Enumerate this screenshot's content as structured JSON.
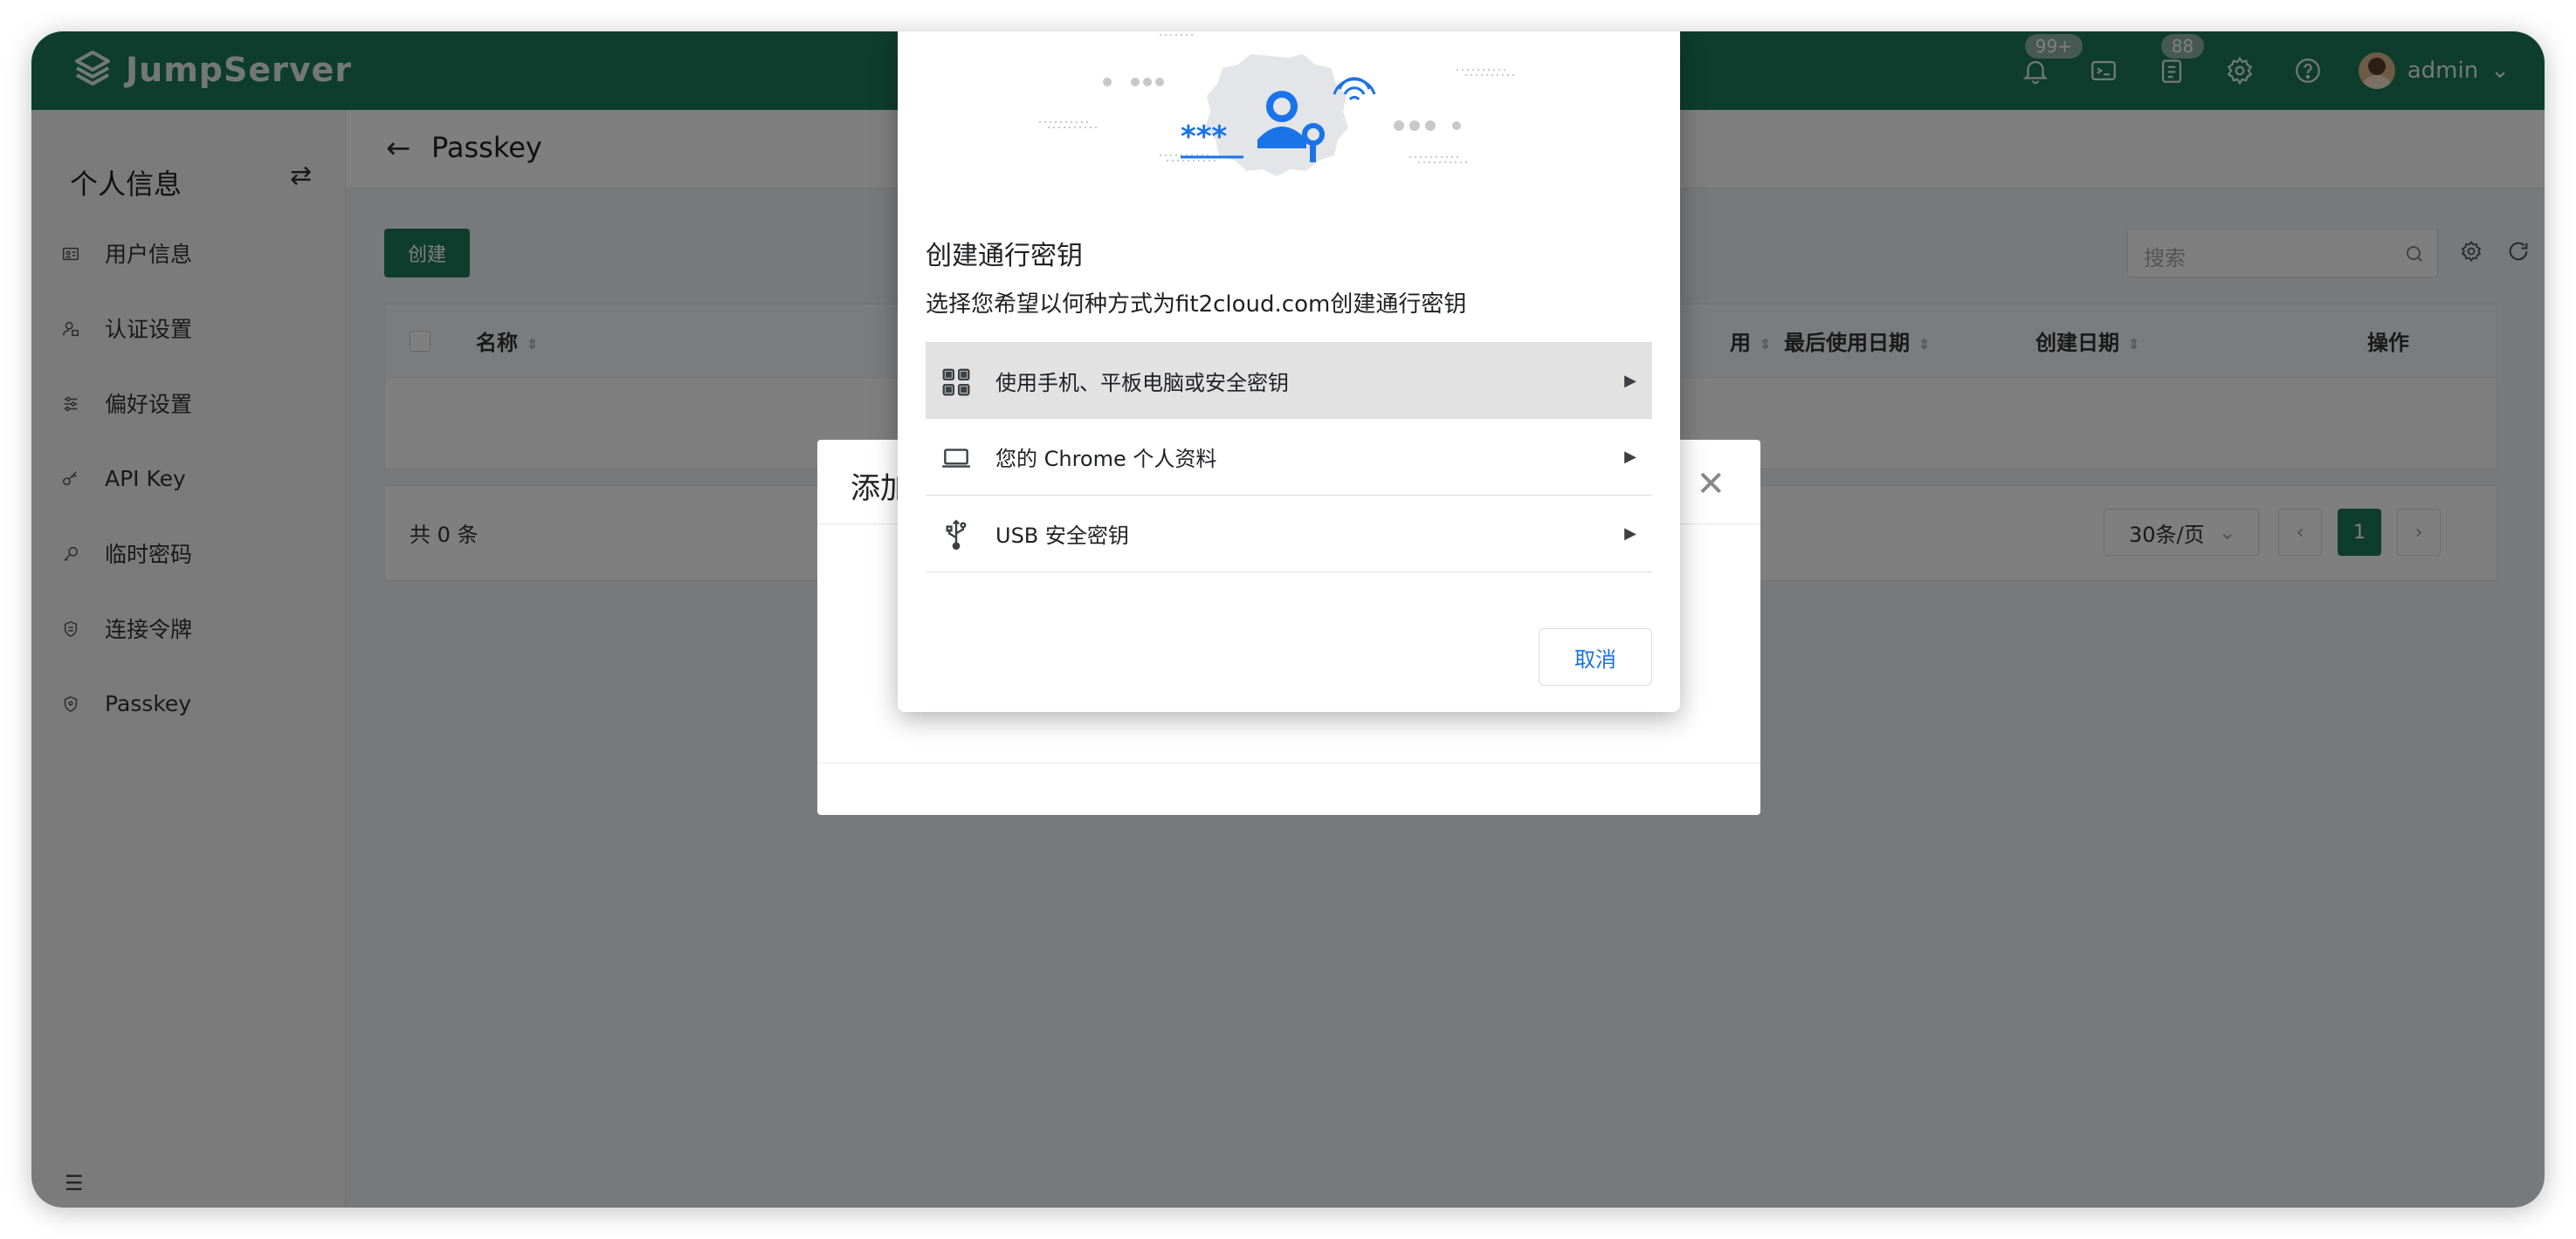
{
  "app": {
    "name": "JumpServer",
    "notifications_badge": "99+",
    "tickets_badge": "88",
    "user": "admin"
  },
  "sidebar": {
    "title": "个人信息",
    "items": [
      {
        "label": "用户信息",
        "icon": "id-card-icon"
      },
      {
        "label": "认证设置",
        "icon": "user-lock-icon"
      },
      {
        "label": "偏好设置",
        "icon": "sliders-icon"
      },
      {
        "label": "API Key",
        "icon": "key-icon"
      },
      {
        "label": "临时密码",
        "icon": "temp-key-icon"
      },
      {
        "label": "连接令牌",
        "icon": "token-icon"
      },
      {
        "label": "Passkey",
        "icon": "shield-icon"
      }
    ]
  },
  "page": {
    "title": "Passkey",
    "create_label": "创建",
    "search_placeholder": "搜索",
    "columns": [
      "名称",
      "用",
      "最后使用日期",
      "创建日期",
      "操作"
    ],
    "total": "共 0 条",
    "page_size": "30条/页",
    "current_page": "1"
  },
  "add_dialog": {
    "title": "添加"
  },
  "passkey_chooser": {
    "title": "创建通行密钥",
    "subtitle": "选择您希望以何种方式为fit2cloud.com创建通行密钥",
    "options": [
      {
        "label": "使用手机、平板电脑或安全密钥",
        "icon": "qr-code-icon"
      },
      {
        "label": "您的 Chrome 个人资料",
        "icon": "laptop-icon"
      },
      {
        "label": "USB 安全密钥",
        "icon": "usb-icon"
      }
    ],
    "cancel_label": "取消",
    "accent_color": "#1a73e8"
  },
  "colors": {
    "brand": "#1f7a5b"
  }
}
